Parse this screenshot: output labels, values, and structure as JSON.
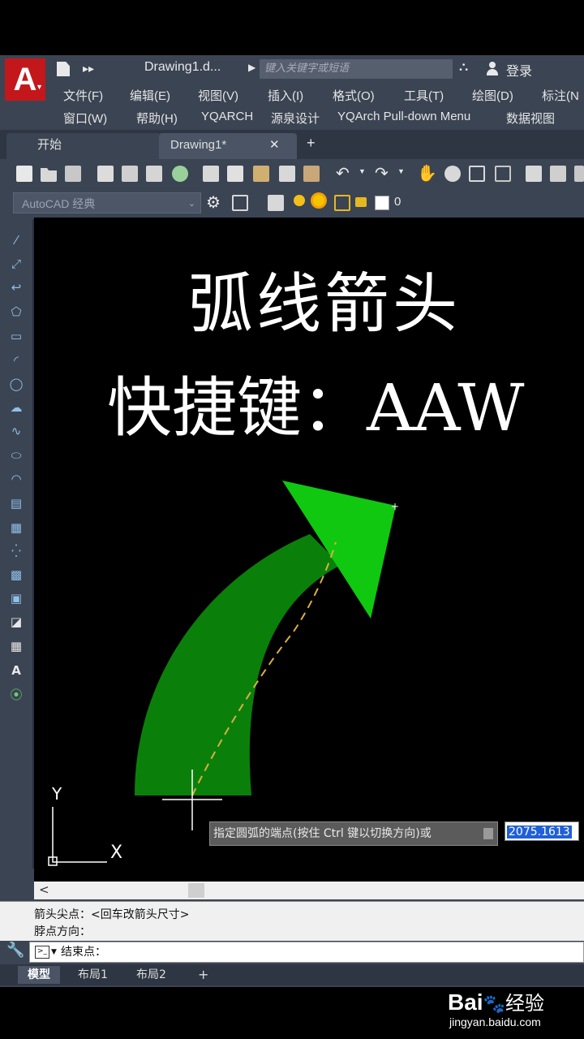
{
  "app": {
    "filename": "Drawing1.d...",
    "search_placeholder": "键入关键字或短语",
    "login": "登录"
  },
  "menu_row1": [
    "文件(F)",
    "编辑(E)",
    "视图(V)",
    "插入(I)",
    "格式(O)",
    "工具(T)",
    "绘图(D)",
    "标注(N"
  ],
  "menu_row2": [
    "窗口(W)",
    "帮助(H)",
    "YQARCH",
    "源泉设计",
    "YQArch Pull-down Menu",
    "数据视图"
  ],
  "tabs": {
    "start": "开始",
    "drawing": "Drawing1*",
    "close": "✕",
    "add": "+"
  },
  "workspace": "AutoCAD 经典",
  "layer_value": "0",
  "canvas_text": {
    "line1": "弧线箭头",
    "line2": "快捷键：AAW"
  },
  "ucs": {
    "x": "X",
    "y": "Y"
  },
  "tooltip": {
    "prompt": "指定圆弧的端点(按住 Ctrl 键以切换方向)或",
    "value": "2075.1613"
  },
  "command_history": [
    "箭头尖点：<回车改箭头尺寸>",
    "脖点方向："
  ],
  "command_input": "结束点：",
  "layout_tabs": [
    "模型",
    "布局1",
    "布局2",
    "+"
  ],
  "scroll_left": "<",
  "watermark": {
    "brand": "Bai",
    "brand2": "经验",
    "url": "jingyan.baidu.com"
  },
  "colors": {
    "arrow_body": "#0a800a",
    "arrow_head": "#10c810",
    "accent_red": "#c4171c"
  }
}
